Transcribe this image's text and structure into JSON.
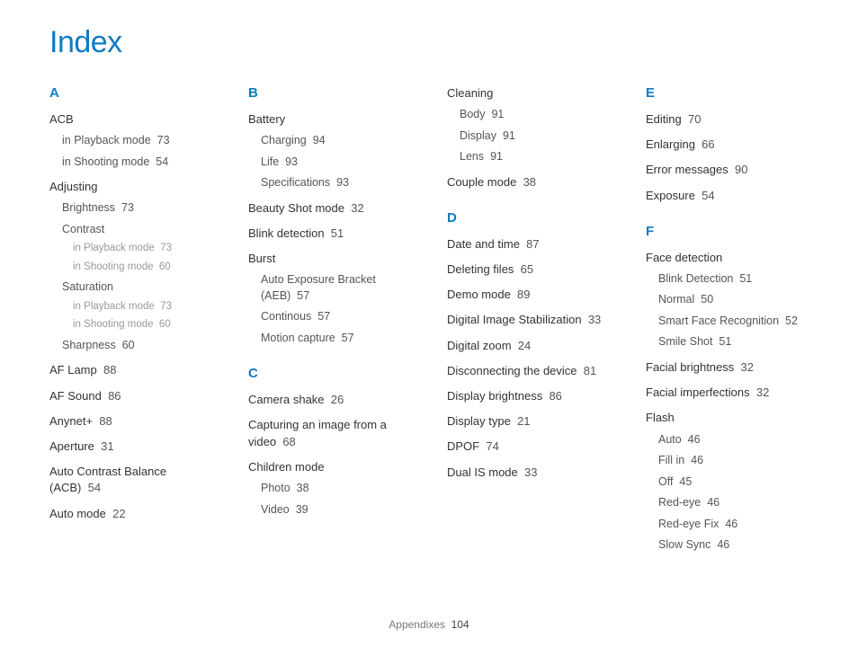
{
  "title": "Index",
  "footer": {
    "section": "Appendixes",
    "page": "104"
  },
  "columns": [
    [
      {
        "letter": "A",
        "entries": [
          {
            "term": "ACB",
            "page": "",
            "subs": [
              {
                "term": "in Playback mode",
                "page": "73"
              },
              {
                "term": "in Shooting mode",
                "page": "54"
              }
            ]
          },
          {
            "term": "Adjusting",
            "page": "",
            "subs": [
              {
                "term": "Brightness",
                "page": "73"
              },
              {
                "term": "Contrast",
                "page": "",
                "subs": [
                  {
                    "term": "in Playback mode",
                    "page": "73"
                  },
                  {
                    "term": "in Shooting mode",
                    "page": "60"
                  }
                ]
              },
              {
                "term": "Saturation",
                "page": "",
                "subs": [
                  {
                    "term": "in Playback mode",
                    "page": "73"
                  },
                  {
                    "term": "in Shooting mode",
                    "page": "60"
                  }
                ]
              },
              {
                "term": "Sharpness",
                "page": "60"
              }
            ]
          },
          {
            "term": "AF Lamp",
            "page": "88"
          },
          {
            "term": "AF Sound",
            "page": "86"
          },
          {
            "term": "Anynet+",
            "page": "88"
          },
          {
            "term": "Aperture",
            "page": "31"
          },
          {
            "term": "Auto Contrast Balance (ACB)",
            "page": "54"
          },
          {
            "term": "Auto mode",
            "page": "22"
          }
        ]
      }
    ],
    [
      {
        "letter": "B",
        "entries": [
          {
            "term": "Battery",
            "page": "",
            "subs": [
              {
                "term": "Charging",
                "page": "94"
              },
              {
                "term": "Life",
                "page": "93"
              },
              {
                "term": "Specifications",
                "page": "93"
              }
            ]
          },
          {
            "term": "Beauty Shot mode",
            "page": "32"
          },
          {
            "term": "Blink detection",
            "page": "51"
          },
          {
            "term": "Burst",
            "page": "",
            "subs": [
              {
                "term": "Auto Exposure Bracket (AEB)",
                "page": "57"
              },
              {
                "term": "Continous",
                "page": "57"
              },
              {
                "term": "Motion capture",
                "page": "57"
              }
            ]
          }
        ]
      },
      {
        "letter": "C",
        "entries": [
          {
            "term": "Camera shake",
            "page": "26"
          },
          {
            "term": "Capturing an image from a video",
            "page": "68"
          },
          {
            "term": "Children mode",
            "page": "",
            "subs": [
              {
                "term": "Photo",
                "page": "38"
              },
              {
                "term": "Video",
                "page": "39"
              }
            ]
          }
        ]
      }
    ],
    [
      {
        "letter": "",
        "entries": [
          {
            "term": "Cleaning",
            "page": "",
            "subs": [
              {
                "term": "Body",
                "page": "91"
              },
              {
                "term": "Display",
                "page": "91"
              },
              {
                "term": "Lens",
                "page": "91"
              }
            ]
          },
          {
            "term": "Couple mode",
            "page": "38"
          }
        ]
      },
      {
        "letter": "D",
        "entries": [
          {
            "term": "Date and time",
            "page": "87"
          },
          {
            "term": "Deleting files",
            "page": "65"
          },
          {
            "term": "Demo mode",
            "page": "89"
          },
          {
            "term": "Digital Image Stabilization",
            "page": "33"
          },
          {
            "term": "Digital zoom",
            "page": "24"
          },
          {
            "term": "Disconnecting the device",
            "page": "81"
          },
          {
            "term": "Display brightness",
            "page": "86"
          },
          {
            "term": "Display type",
            "page": "21"
          },
          {
            "term": "DPOF",
            "page": "74"
          },
          {
            "term": "Dual IS mode",
            "page": "33"
          }
        ]
      }
    ],
    [
      {
        "letter": "E",
        "entries": [
          {
            "term": "Editing",
            "page": "70"
          },
          {
            "term": "Enlarging",
            "page": "66"
          },
          {
            "term": "Error messages",
            "page": "90"
          },
          {
            "term": "Exposure",
            "page": "54"
          }
        ]
      },
      {
        "letter": "F",
        "entries": [
          {
            "term": "Face detection",
            "page": "",
            "subs": [
              {
                "term": "Blink Detection",
                "page": "51"
              },
              {
                "term": "Normal",
                "page": "50"
              },
              {
                "term": "Smart Face Recognition",
                "page": "52"
              },
              {
                "term": "Smile Shot",
                "page": "51"
              }
            ]
          },
          {
            "term": "Facial brightness",
            "page": "32"
          },
          {
            "term": "Facial imperfections",
            "page": "32"
          },
          {
            "term": "Flash",
            "page": "",
            "subs": [
              {
                "term": "Auto",
                "page": "46"
              },
              {
                "term": "Fill in",
                "page": "46"
              },
              {
                "term": "Off",
                "page": "45"
              },
              {
                "term": "Red-eye",
                "page": "46"
              },
              {
                "term": "Red-eye Fix",
                "page": "46"
              },
              {
                "term": "Slow Sync",
                "page": "46"
              }
            ]
          }
        ]
      }
    ]
  ]
}
